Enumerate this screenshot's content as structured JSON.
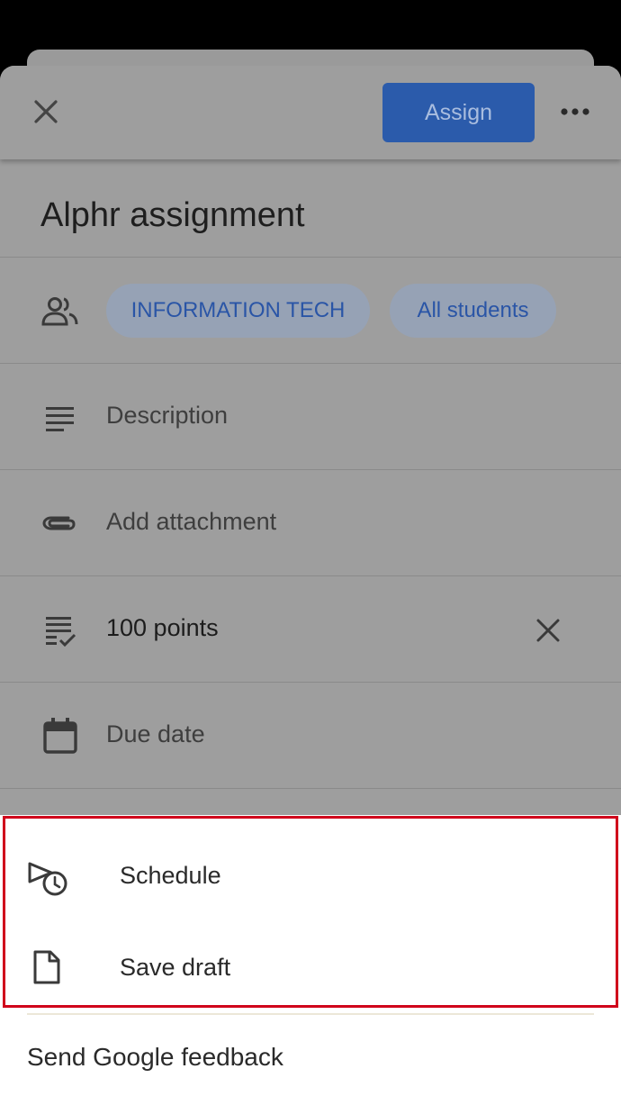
{
  "header": {
    "assign_label": "Assign"
  },
  "assignment": {
    "title": "Alphr assignment",
    "class_chip": "INFORMATION TECH",
    "students_chip": "All students",
    "description_placeholder": "Description",
    "attachment_placeholder": "Add attachment",
    "points_value": "100 points",
    "due_date_placeholder": "Due date"
  },
  "menu": {
    "schedule_label": "Schedule",
    "save_draft_label": "Save draft",
    "feedback_label": "Send Google feedback"
  },
  "colors": {
    "accent": "#2b5bab",
    "highlight": "#d0021b"
  }
}
